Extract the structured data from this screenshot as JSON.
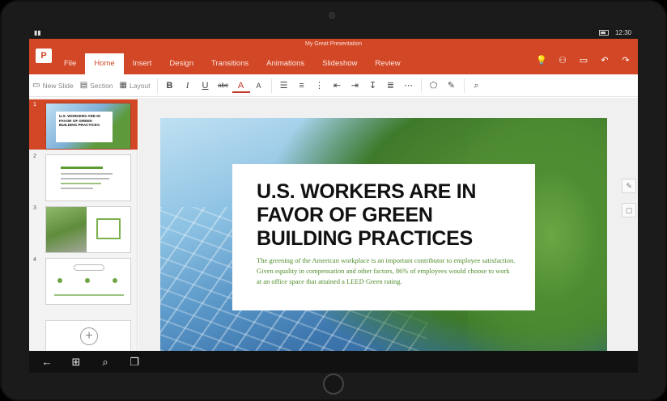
{
  "status": {
    "time": "12:30"
  },
  "document": {
    "title": "My Great Presentation"
  },
  "app": {
    "logo_letter": "P"
  },
  "tabs": [
    {
      "label": "File"
    },
    {
      "label": "Home"
    },
    {
      "label": "Insert"
    },
    {
      "label": "Design"
    },
    {
      "label": "Transitions"
    },
    {
      "label": "Animations"
    },
    {
      "label": "Slideshow"
    },
    {
      "label": "Review"
    }
  ],
  "active_tab": "Home",
  "ribbon": {
    "new_slide": "New Slide",
    "section": "Section",
    "layout": "Layout",
    "bold": "B",
    "italic": "I",
    "underline": "U",
    "strike": "abc",
    "font_color": "A",
    "highlight": "A"
  },
  "thumbnails": [
    {
      "number": "1",
      "caption": "U.S. WORKERS ARE IN FAVOR OF GREEN BUILDING PRACTICES"
    },
    {
      "number": "2"
    },
    {
      "number": "3"
    },
    {
      "number": "4"
    }
  ],
  "slide": {
    "heading_line1": "U.S. WORKERS ARE IN",
    "heading_line2": "FAVOR OF GREEN",
    "heading_line3": "BUILDING PRACTICES",
    "body": "The greening of the American workplace is an important contributor to employee satisfaction. Given equality in compensation and other factors, 86% of employees would choose to work at an office space that attained a LEED Green rating."
  },
  "colors": {
    "accent": "#d24726",
    "green_text": "#4f8d2c"
  }
}
